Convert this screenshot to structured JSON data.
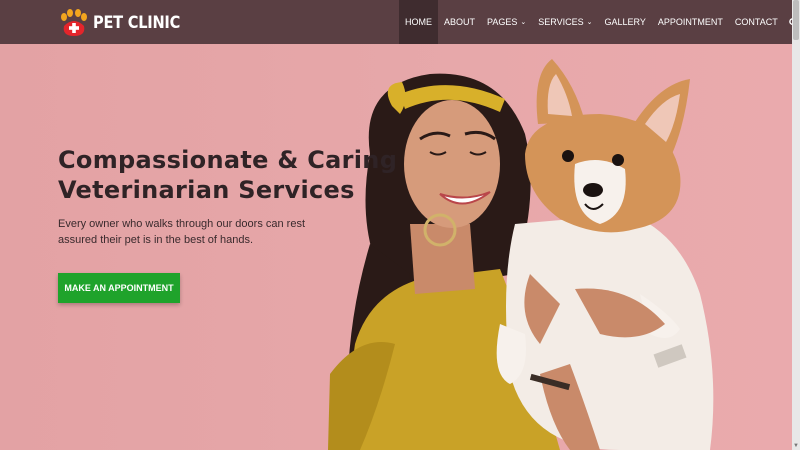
{
  "brand": {
    "name": "PET CLINIC"
  },
  "nav": {
    "items": [
      {
        "label": "HOME",
        "dropdown": false,
        "active": true
      },
      {
        "label": "ABOUT",
        "dropdown": false
      },
      {
        "label": "PAGES",
        "dropdown": true
      },
      {
        "label": "SERVICES",
        "dropdown": true
      },
      {
        "label": "GALLERY",
        "dropdown": false
      },
      {
        "label": "APPOINTMENT",
        "dropdown": false
      },
      {
        "label": "CONTACT",
        "dropdown": false
      }
    ],
    "search_icon": "search-icon"
  },
  "hero": {
    "title_line1": "Compassionate & Caring",
    "title_line2": "Veterinarian Services",
    "subtitle": "Every owner who walks through our doors can rest assured their pet is in the best of hands.",
    "cta_label": "MAKE AN APPOINTMENT"
  },
  "colors": {
    "header_bg": "#5a3f43",
    "hero_bg": "#e7a8aa",
    "cta_bg": "#1fa32b",
    "logo_paw": "#f2a51e",
    "logo_cross_bg": "#e4252b"
  }
}
